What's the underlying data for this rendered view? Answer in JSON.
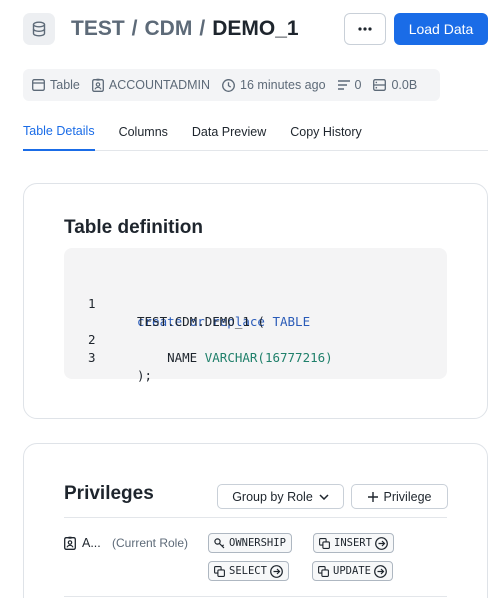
{
  "header": {
    "database": "TEST",
    "schema": "CDM",
    "table": "DEMO_1",
    "separator": "/",
    "icon": "database-icon",
    "more_label": "···",
    "load_data_label": "Load Data"
  },
  "meta": {
    "type": "Table",
    "owner": "ACCOUNTADMIN",
    "modified": "16 minutes ago",
    "rows": "0",
    "size": "0.0B"
  },
  "tabs": [
    {
      "label": "Table Details",
      "active": true
    },
    {
      "label": "Columns",
      "active": false
    },
    {
      "label": "Data Preview",
      "active": false
    },
    {
      "label": "Copy History",
      "active": false
    }
  ],
  "definition": {
    "title": "Table definition",
    "lines": [
      {
        "number": "1",
        "kw": "create or replace",
        "rest": "TABLE"
      },
      {
        "number": "",
        "text": "TEST.CDM.DEMO_1 ("
      },
      {
        "number": "2",
        "indent": "    ",
        "text": "NAME",
        "type": "VARCHAR(16777216)"
      },
      {
        "number": "3",
        "text": ");"
      }
    ]
  },
  "privileges": {
    "title": "Privileges",
    "group_by_label": "Group by Role",
    "add_label": "Privilege",
    "role": {
      "name": "A...",
      "note": "(Current Role)",
      "privileges": [
        "OWNERSHIP",
        "INSERT",
        "SELECT",
        "UPDATE"
      ]
    }
  },
  "colors": {
    "accent": "#1a6ce7",
    "keyword": "#2a5bb8",
    "type": "#20806b"
  }
}
